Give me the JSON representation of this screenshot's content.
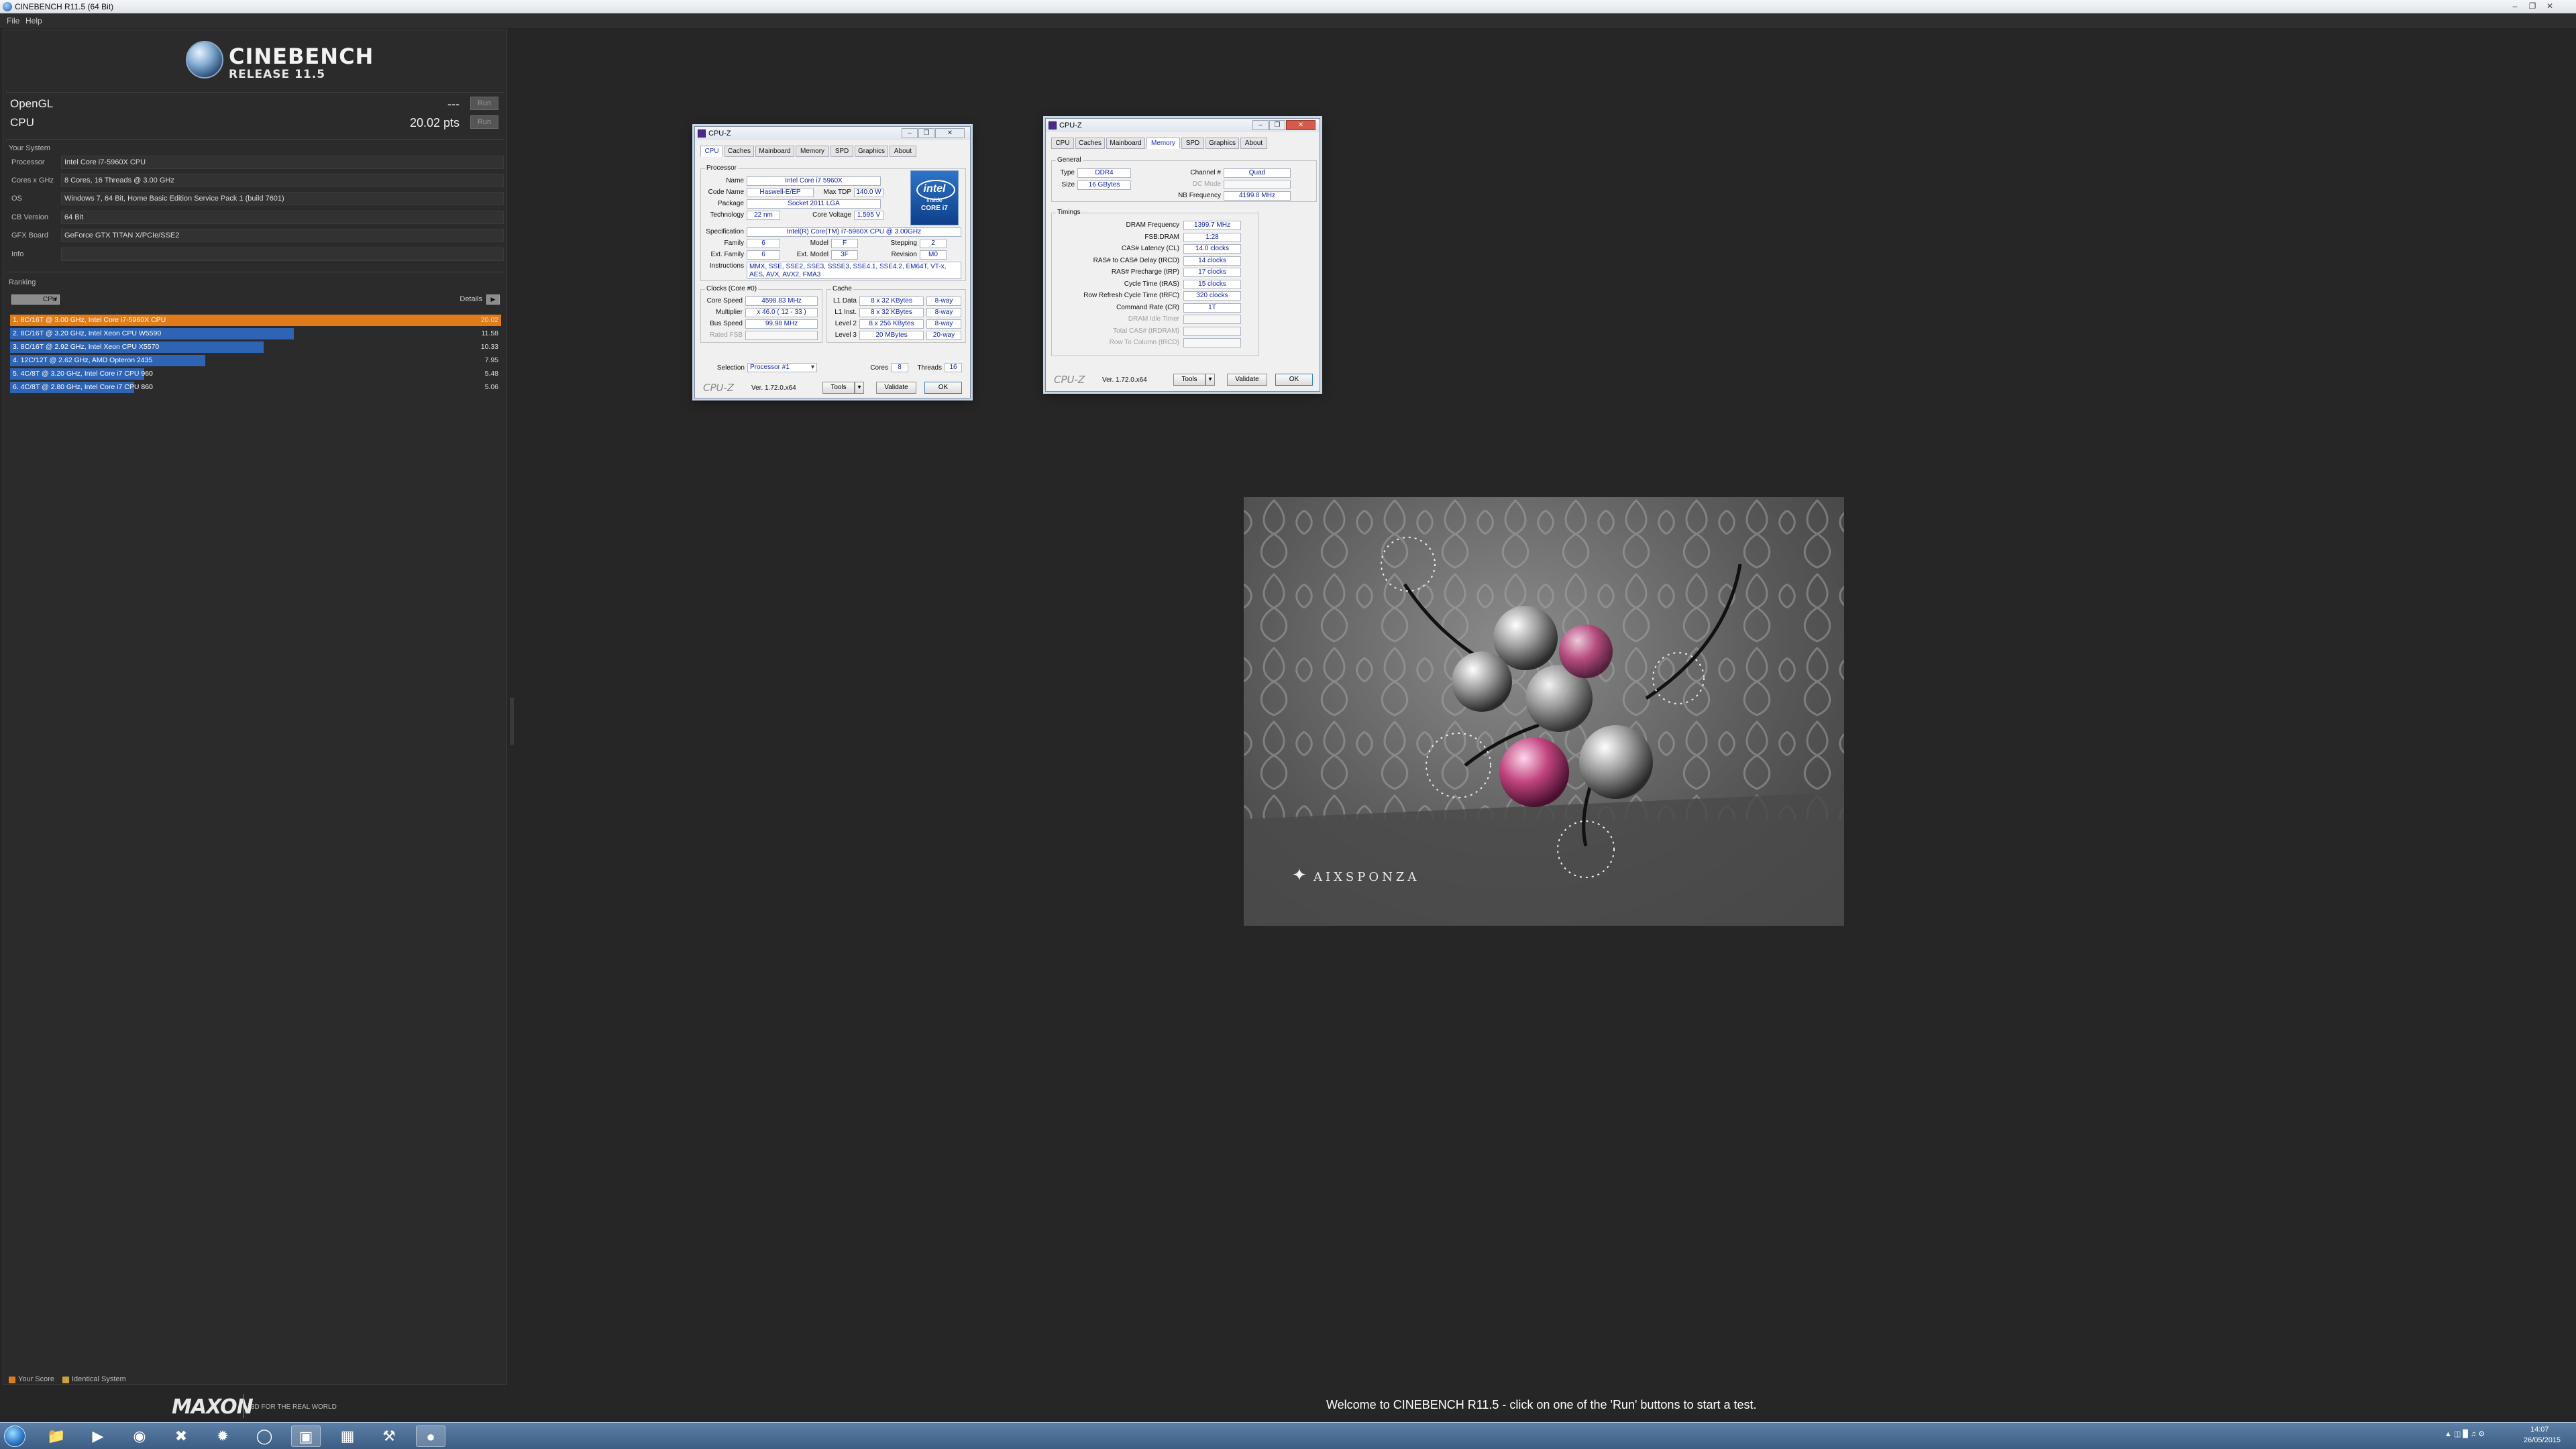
{
  "window": {
    "title": "CINEBENCH R11.5 (64 Bit)"
  },
  "menu": [
    "File",
    "Help"
  ],
  "logo": {
    "line1": "CINEBENCH",
    "line2": "RELEASE 11.5"
  },
  "benchmarks": [
    {
      "name": "OpenGL",
      "score": "---",
      "run": "Run"
    },
    {
      "name": "CPU",
      "score": "20.02 pts",
      "run": "Run"
    }
  ],
  "system": {
    "title": "Your System",
    "rows": [
      {
        "key": "Processor",
        "value": "Intel Core i7-5960X CPU"
      },
      {
        "key": "Cores x GHz",
        "value": "8 Cores, 16 Threads @ 3.00 GHz"
      },
      {
        "key": "OS",
        "value": "Windows 7, 64 Bit, Home Basic Edition Service Pack 1 (build 7601)"
      },
      {
        "key": "CB Version",
        "value": "64 Bit"
      },
      {
        "key": "GFX Board",
        "value": "GeForce GTX TITAN X/PCIe/SSE2"
      },
      {
        "key": "Info",
        "value": ""
      }
    ]
  },
  "ranking": {
    "title": "Ranking",
    "dropdown": "CPU",
    "details": "Details",
    "entries": [
      {
        "label": "1. 8C/16T @ 3.00 GHz, Intel Core i7-5960X CPU",
        "score": 20.02,
        "text": "20.02",
        "highlight": true
      },
      {
        "label": "2. 8C/16T @ 3.20 GHz, Intel Xeon CPU W5590",
        "score": 11.58,
        "text": "11.58"
      },
      {
        "label": "3. 8C/16T @ 2.92 GHz, Intel Xeon CPU X5570",
        "score": 10.33,
        "text": "10.33"
      },
      {
        "label": "4. 12C/12T @ 2.62 GHz, AMD Opteron 2435",
        "score": 7.95,
        "text": "7.95"
      },
      {
        "label": "5. 4C/8T @ 3.20 GHz, Intel Core i7 CPU 960",
        "score": 5.48,
        "text": "5.48"
      },
      {
        "label": "6. 4C/8T @ 2.80 GHz, Intel Core i7 CPU 860",
        "score": 5.06,
        "text": "5.06"
      }
    ]
  },
  "legend": {
    "your_score": "Your Score",
    "identical": "Identical System"
  },
  "maxon": {
    "brand": "MAXON",
    "tagline": "3D FOR THE REAL WORLD"
  },
  "status": "Welcome to CINEBENCH R11.5 - click on one of the 'Run' buttons to start a test.",
  "cpuz_cpu": {
    "title": "CPU-Z",
    "tabs": [
      "CPU",
      "Caches",
      "Mainboard",
      "Memory",
      "SPD",
      "Graphics",
      "About"
    ],
    "processor_group": "Processor",
    "name_label": "Name",
    "name": "Intel Core i7 5960X",
    "codename_label": "Code Name",
    "codename": "Haswell-E/EP",
    "maxtdp_label": "Max TDP",
    "maxtdp": "140.0 W",
    "package_label": "Package",
    "package": "Socket 2011 LGA",
    "tech_label": "Technology",
    "tech": "22 nm",
    "cv_label": "Core Voltage",
    "cv": "1.595 V",
    "spec_label": "Specification",
    "spec": "Intel(R) Core(TM) i7-5960X CPU @ 3.00GHz",
    "family_label": "Family",
    "family": "6",
    "model_label": "Model",
    "model": "F",
    "stepping_label": "Stepping",
    "stepping": "2",
    "extfam_label": "Ext. Family",
    "extfam": "6",
    "extmodel_label": "Ext. Model",
    "extmodel": "3F",
    "rev_label": "Revision",
    "rev": "M0",
    "instr_label": "Instructions",
    "instr": "MMX, SSE, SSE2, SSE3, SSSE3, SSE4.1, SSE4.2, EM64T, VT-x, AES, AVX, AVX2, FMA3",
    "intel": {
      "brand": "intel",
      "line": "inside",
      "core": "CORE i7"
    },
    "clocks_group": "Clocks (Core #0)",
    "corespeed_label": "Core Speed",
    "corespeed": "4598.83 MHz",
    "mult_label": "Multiplier",
    "mult": "x 46.0 ( 12 - 33 )",
    "bus_label": "Bus Speed",
    "bus": "99.98 MHz",
    "fsb_label": "Rated FSB",
    "fsb": "",
    "cache_group": "Cache",
    "l1d_label": "L1 Data",
    "l1d": "8 x 32 KBytes",
    "l1d_way": "8-way",
    "l1i_label": "L1 Inst.",
    "l1i": "8 x 32 KBytes",
    "l1i_way": "8-way",
    "l2_label": "Level 2",
    "l2": "8 x 256 KBytes",
    "l2_way": "8-way",
    "l3_label": "Level 3",
    "l3": "20 MBytes",
    "l3_way": "20-way",
    "selection_label": "Selection",
    "selection": "Processor #1",
    "cores_label": "Cores",
    "cores": "8",
    "threads_label": "Threads",
    "threads": "16",
    "brand": "CPU-Z",
    "version": "Ver. 1.72.0.x64",
    "tools": "Tools",
    "validate": "Validate",
    "ok": "OK"
  },
  "cpuz_mem": {
    "title": "CPU-Z",
    "tabs": [
      "CPU",
      "Caches",
      "Mainboard",
      "Memory",
      "SPD",
      "Graphics",
      "About"
    ],
    "general_group": "General",
    "type_label": "Type",
    "type": "DDR4",
    "channel_label": "Channel #",
    "channel": "Quad",
    "dcmode_label": "DC Mode",
    "dcmode": "",
    "size_label": "Size",
    "size": "16 GBytes",
    "nbfreq_label": "NB Frequency",
    "nbfreq": "4199.8 MHz",
    "timings_group": "Timings",
    "timings": [
      {
        "label": "DRAM Frequency",
        "value": "1399.7 MHz"
      },
      {
        "label": "FSB:DRAM",
        "value": "1:28"
      },
      {
        "label": "CAS# Latency (CL)",
        "value": "14.0 clocks"
      },
      {
        "label": "RAS# to CAS# Delay (tRCD)",
        "value": "14 clocks"
      },
      {
        "label": "RAS# Precharge (tRP)",
        "value": "17 clocks"
      },
      {
        "label": "Cycle Time (tRAS)",
        "value": "15 clocks"
      },
      {
        "label": "Row Refresh Cycle Time (tRFC)",
        "value": "320 clocks"
      },
      {
        "label": "Command Rate (CR)",
        "value": "1T"
      },
      {
        "label": "DRAM Idle Timer",
        "value": "",
        "dim": true
      },
      {
        "label": "Total CAS# (tRDRAM)",
        "value": "",
        "dim": true
      },
      {
        "label": "Row To Column (tRCD)",
        "value": "",
        "dim": true
      }
    ],
    "brand": "CPU-Z",
    "version": "Ver. 1.72.0.x64",
    "tools": "Tools",
    "validate": "Validate",
    "ok": "OK"
  },
  "render": {
    "watermark": "AIXSPONZA"
  },
  "tray": {
    "time": "14:07",
    "date": "26/05/2015"
  }
}
